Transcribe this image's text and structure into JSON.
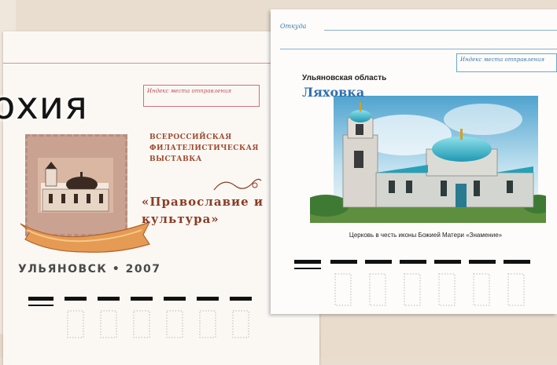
{
  "left_envelope": {
    "index_box_label": "Индекс места отправления",
    "title_fragment": "охия",
    "exhibition_lines": [
      "Всероссийская",
      "филателистическая",
      "выставка"
    ],
    "exhibition_title": "«Православие и культура»",
    "city_year": "УЛЬЯНОВСК • 2007"
  },
  "right_envelope": {
    "from_label": "Откуда",
    "index_box_label": "Индекс места отправления",
    "region": "Ульяновская область",
    "village": "Ляховка",
    "caption": "Церковь в честь иконы Божией Матери «Знамение»"
  },
  "colors": {
    "background": "#e9ddd0",
    "left_accent": "#a14a2f",
    "right_accent": "#2f6fb0"
  }
}
